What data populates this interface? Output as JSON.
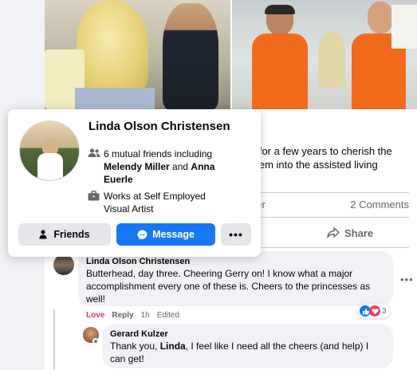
{
  "hover_card": {
    "name": "Linda Olson Christensen",
    "mutual_prefix": "6 mutual friends including",
    "mutual_name1": "Melendy Miller",
    "mutual_and": "and",
    "mutual_name2_line1": "Anna",
    "mutual_name2_line2": "Euerle",
    "work_line1": "Works at Self Employed",
    "work_line2": "Visual Artist",
    "buttons": {
      "friends": "Friends",
      "message": "Message",
      "more": "•••"
    }
  },
  "post": {
    "text_line1": "d for a few years to cherish the",
    "text_line2": "them into the assisted living",
    "stats_left": "her",
    "comments_count": "2 Comments",
    "share_label": "Share"
  },
  "comments": [
    {
      "author": "Linda Olson Christensen",
      "lines": [
        "Butterhead, day three. Cheering Gerry on! I know what a major",
        "accomplishment every one of these is. Cheers to the princesses as",
        "well!"
      ],
      "actions": {
        "reaction": "Love",
        "reply": "Reply",
        "time": "1h",
        "edited": "Edited"
      },
      "reaction_count": "3"
    },
    {
      "author": "Gerard Kulzer",
      "text_before": "Thank you, ",
      "text_bold": "Linda",
      "text_after": ", I feel like I need all the cheers (and help) I",
      "line2": "can get!"
    }
  ],
  "more_dots": "•••",
  "colors": {
    "accent": "#1877f2",
    "love": "#e4324e",
    "online": "#31a24c",
    "tshirt": "#f26b1d"
  },
  "icons": [
    "friends-icon",
    "briefcase-icon",
    "person-check-icon",
    "messenger-icon",
    "share-icon",
    "like-icon",
    "heart-icon"
  ]
}
